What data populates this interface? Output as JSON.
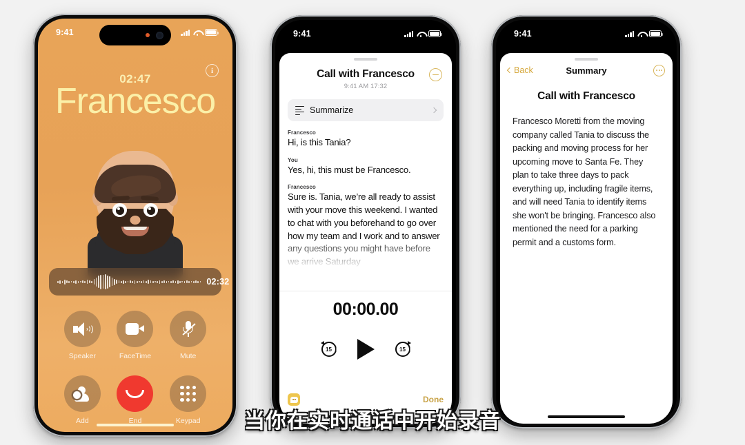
{
  "subtitle": "当你在实时通话中开始录音",
  "phone1": {
    "status": {
      "time": "9:41",
      "signal_icon": "cellular-bars-icon",
      "wifi_icon": "wifi-icon",
      "battery_icon": "battery-icon"
    },
    "info_button": "i",
    "call_timer": "02:47",
    "caller_name": "Francesco",
    "recording": {
      "time": "02:32",
      "stop_label": "record-stop"
    },
    "controls": [
      {
        "label": "Speaker",
        "icon": "speaker-icon"
      },
      {
        "label": "FaceTime",
        "icon": "video-camera-icon"
      },
      {
        "label": "Mute",
        "icon": "microphone-muted-icon"
      },
      {
        "label": "Add",
        "icon": "add-person-icon"
      },
      {
        "label": "End",
        "icon": "hang-up-icon"
      },
      {
        "label": "Keypad",
        "icon": "keypad-icon"
      }
    ]
  },
  "phone2": {
    "status": {
      "time": "9:41"
    },
    "title": "Call with Francesco",
    "subtitle": "9:41 AM  17:32",
    "collapse_icon": "minus-circle-icon",
    "summarize": {
      "label": "Summarize",
      "icon": "summarize-lines-icon",
      "chevron": "chevron-right-icon"
    },
    "transcript": [
      {
        "speaker": "Francesco",
        "text": "Hi, is this Tania?"
      },
      {
        "speaker": "You",
        "text": "Yes, hi, this must be Francesco."
      },
      {
        "speaker": "Francesco",
        "text": "Sure is. Tania, we’re all ready to assist with your move this weekend. I wanted to chat with you beforehand to go over how my team and I work and to answer any questions you might have before we arrive Saturday"
      }
    ],
    "player": {
      "time": "00:00.00",
      "skip_back": "15",
      "skip_forward": "15",
      "play_icon": "play-icon"
    },
    "footer": {
      "bubble_icon": "message-bubble-icon",
      "done_label": "Done"
    }
  },
  "phone3": {
    "status": {
      "time": "9:41"
    },
    "nav": {
      "back_label": "Back",
      "title": "Summary",
      "more_icon": "more-circle-icon"
    },
    "title": "Call with Francesco",
    "body": "Francesco Moretti from the moving company called Tania to discuss the packing and moving process for her upcoming move to Santa Fe. They plan to take three days to pack everything up, including fragile items, and will need Tania to identify items she won't be bringing. Francesco also mentioned the need for a parking permit and a customs form."
  },
  "colors": {
    "page_bg": "#f2f2f2",
    "call_bg": "#e8a458",
    "caller_name": "#fbf0a8",
    "end_red": "#f0392f",
    "record_red": "#e8342b",
    "accent_gold": "#d6a93f"
  }
}
